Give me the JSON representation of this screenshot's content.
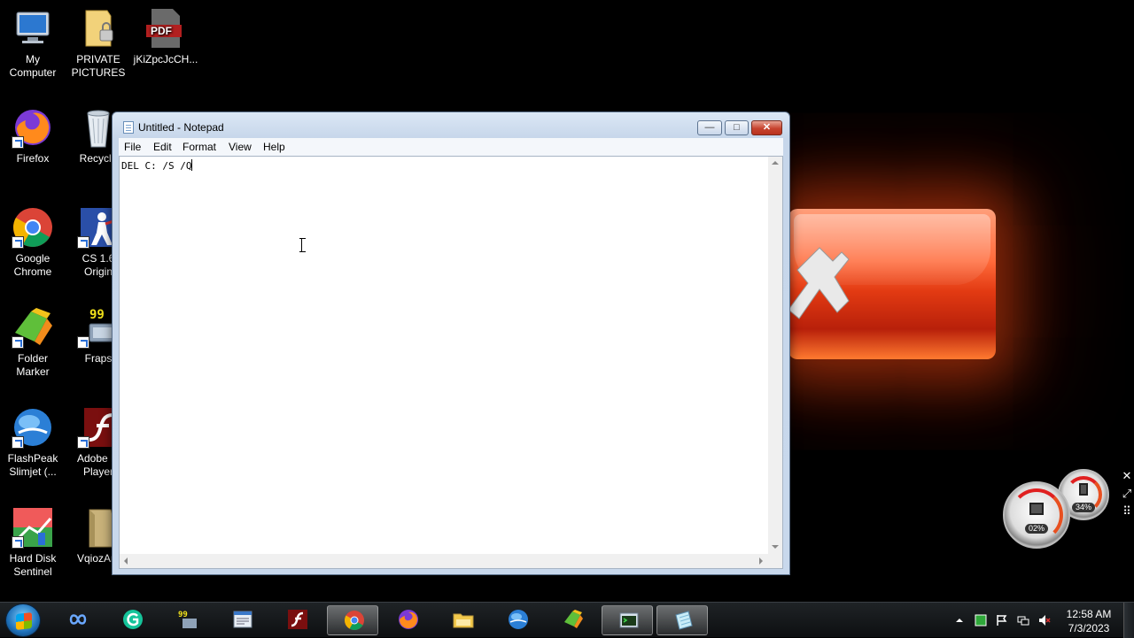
{
  "desktop": {
    "icons": [
      {
        "label": "My\nComputer",
        "icon": "computer-icon"
      },
      {
        "label": "PRIVATE\nPICTURES",
        "icon": "locked-folder-icon"
      },
      {
        "label": "jKiZpcJcCH...",
        "icon": "pdf-icon"
      },
      {
        "label": "Firefox",
        "icon": "firefox-icon"
      },
      {
        "label": "Recycle",
        "icon": "recycle-bin-icon"
      },
      {
        "label": "Google\nChrome",
        "icon": "chrome-icon"
      },
      {
        "label": "CS 1.6\nOrigin",
        "icon": "counter-strike-icon"
      },
      {
        "label": "Folder\nMarker",
        "icon": "folder-marker-icon"
      },
      {
        "label": "Fraps",
        "icon": "fraps-icon"
      },
      {
        "label": "FlashPeak\nSlimjet (...",
        "icon": "slimjet-icon"
      },
      {
        "label": "Adobe Fl\nPlayer",
        "icon": "flash-player-icon"
      },
      {
        "label": "Hard Disk\nSentinel",
        "icon": "hard-disk-sentinel-icon"
      },
      {
        "label": "VqiozAm",
        "icon": "folder-icon"
      }
    ]
  },
  "notepad": {
    "title": "Untitled - Notepad",
    "menu": [
      "File",
      "Edit",
      "Format",
      "View",
      "Help"
    ],
    "content": "DEL C: /S /Q",
    "controls": {
      "minimize": "—",
      "maximize": "□",
      "close": "✕"
    }
  },
  "gadget": {
    "cpu_percent": "02%",
    "memory_percent": "34%",
    "tools": [
      "✕",
      "⤢",
      "⠿"
    ]
  },
  "taskbar": {
    "items": [
      "infinity-icon",
      "grammarly-icon",
      "fraps-icon",
      "notepad-doc-icon",
      "flash-icon",
      "chrome-icon",
      "firefox-icon",
      "explorer-icon",
      "globe-icon",
      "folder-marker-icon",
      "terminal-icon",
      "notepad-icon"
    ],
    "active_items": [
      "chrome-icon",
      "terminal-icon",
      "notepad-icon"
    ],
    "clock_time": "12:58 AM",
    "clock_date": "7/3/2023"
  },
  "colors": {
    "accent_red": "#e23a12",
    "window_frame": "#c6d6ea"
  }
}
